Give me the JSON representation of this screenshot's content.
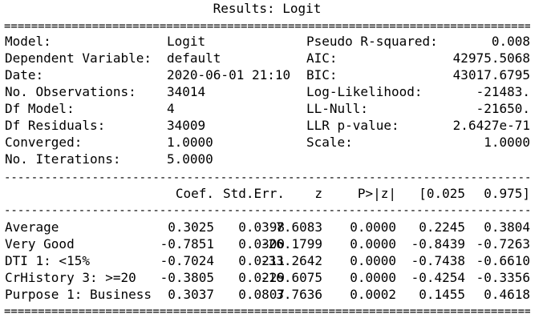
{
  "title": "Results: Logit",
  "rules": {
    "double": "======================================================================================================",
    "single": "------------------------------------------------------------------------------------------------------"
  },
  "summary": [
    {
      "label": "Model:",
      "value": "Logit",
      "label2": "Pseudo R-squared:",
      "value2": "0.008"
    },
    {
      "label": "Dependent Variable:",
      "value": "default",
      "label2": "AIC:",
      "value2": "42975.5068"
    },
    {
      "label": "Date:",
      "value": "2020-06-01 21:10",
      "label2": "BIC:",
      "value2": "43017.6795"
    },
    {
      "label": "No. Observations:",
      "value": "34014",
      "label2": "Log-Likelihood:",
      "value2": "-21483."
    },
    {
      "label": "Df Model:",
      "value": "4",
      "label2": "LL-Null:",
      "value2": "-21650."
    },
    {
      "label": "Df Residuals:",
      "value": "34009",
      "label2": "LLR p-value:",
      "value2": "2.6427e-71"
    },
    {
      "label": "Converged:",
      "value": "1.0000",
      "label2": "Scale:",
      "value2": "1.0000"
    },
    {
      "label": "No. Iterations:",
      "value": "5.0000",
      "label2": "",
      "value2": ""
    }
  ],
  "coef_headers": [
    "Coef.",
    "Std.Err.",
    "z",
    "P>|z|",
    "[0.025",
    "0.975]"
  ],
  "coef_rows": [
    {
      "name": "Average",
      "values": [
        "0.3025",
        "0.0398",
        "7.6083",
        "0.0000",
        "0.2245",
        "0.3804"
      ]
    },
    {
      "name": "Very Good",
      "values": [
        "-0.7851",
        "0.0300",
        "-26.1799",
        "0.0000",
        "-0.8439",
        "-0.7263"
      ]
    },
    {
      "name": "DTI 1: <15%",
      "values": [
        "-0.7024",
        "0.0211",
        "-33.2642",
        "0.0000",
        "-0.7438",
        "-0.6610"
      ]
    },
    {
      "name": "CrHistory 3: >=20",
      "values": [
        "-0.3805",
        "0.0229",
        "-16.6075",
        "0.0000",
        "-0.4254",
        "-0.3356"
      ]
    },
    {
      "name": "Purpose 1: Business",
      "values": [
        "0.3037",
        "0.0807",
        "3.7636",
        "0.0002",
        "0.1455",
        "0.4618"
      ]
    }
  ]
}
